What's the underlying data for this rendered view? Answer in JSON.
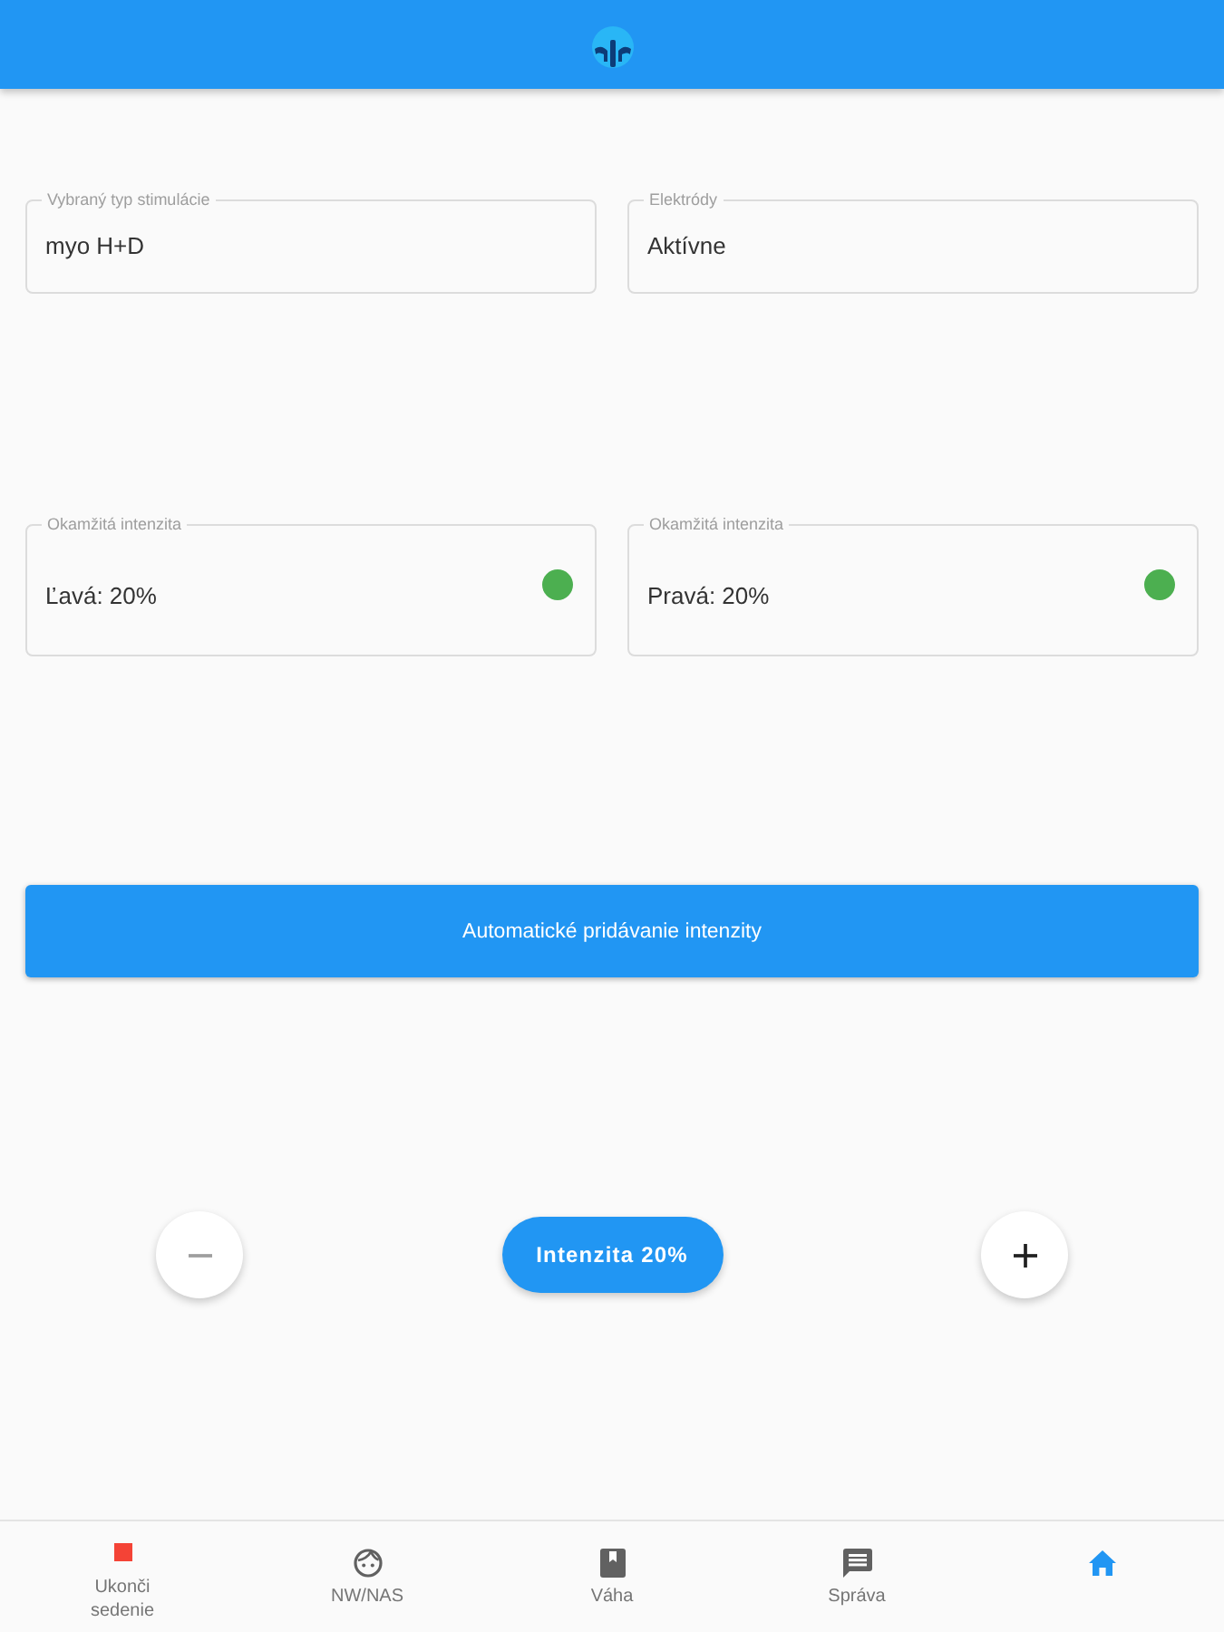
{
  "field_rows": [
    {
      "fields": [
        {
          "label": "Vybraný typ stimulácie",
          "value": "myo H+D"
        },
        {
          "label": "Elektródy",
          "value": "Aktívne"
        }
      ]
    },
    {
      "fields": [
        {
          "label": "Okamžitá intenzita",
          "value": "Ľavá: 20%",
          "color": "#4caf50"
        },
        {
          "label": "Okamžitá intenzita",
          "value": "Pravá: 20%",
          "color": "#4caf50"
        }
      ]
    }
  ],
  "auto_button": {
    "label": "Automatické pridávanie intenzity"
  },
  "intensity": {
    "decrease": {
      "disabled": true
    },
    "label": "Intenzita 20%",
    "increase": {
      "disabled": false
    }
  },
  "bottom_nav": [
    {
      "kind": "end",
      "label": "Ukonči sedenie",
      "selected": false
    },
    {
      "kind": "child",
      "label": "NW/NAS",
      "selected": false
    },
    {
      "kind": "weight",
      "label": "Váha",
      "selected": false
    },
    {
      "kind": "message",
      "label": "Správa",
      "selected": false
    },
    {
      "kind": "home",
      "selected": true
    }
  ]
}
